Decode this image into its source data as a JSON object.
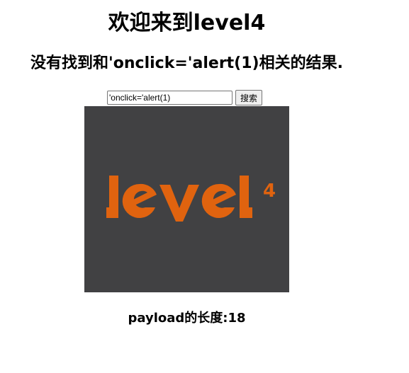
{
  "page": {
    "title": "欢迎来到level4",
    "result_message": "没有找到和'onclick='alert(1)相关的结果.",
    "payload_length_text": "payload的长度:18"
  },
  "search": {
    "input_value": "'onclick='alert(1)",
    "button_label": "搜索"
  },
  "logo": {
    "text": "level",
    "superscript": "4",
    "background_color": "#414143",
    "text_color": "#e0630f"
  }
}
